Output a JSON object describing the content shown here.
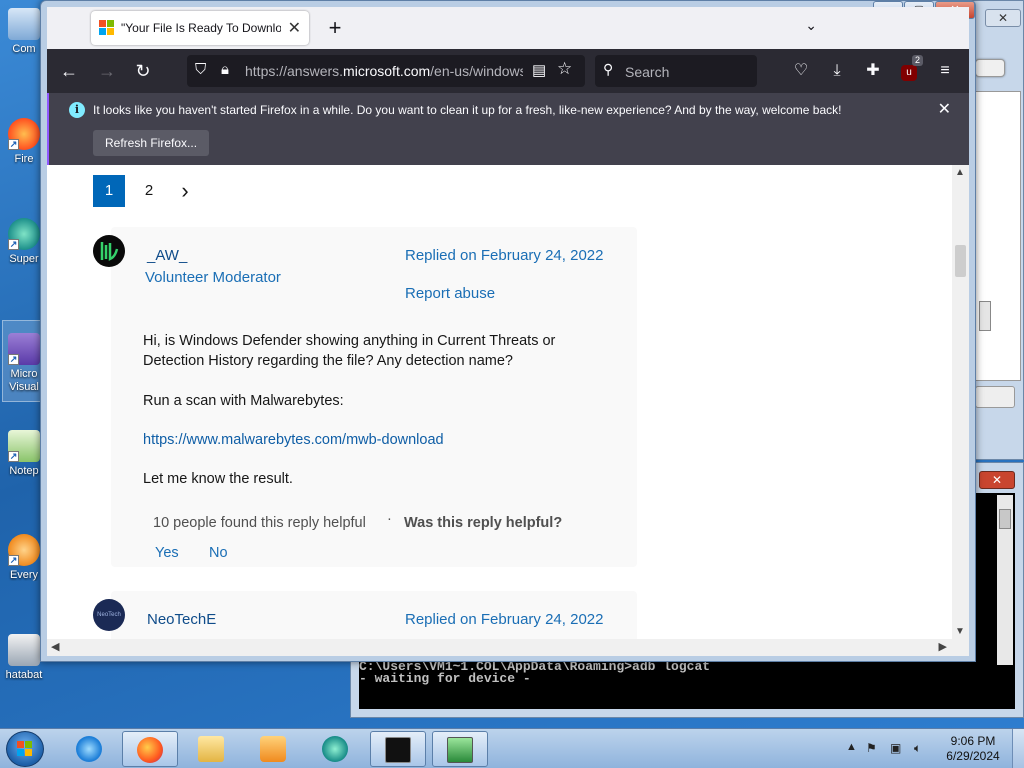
{
  "desktop": {
    "icons": [
      {
        "label": "Com"
      },
      {
        "label": "Fire"
      },
      {
        "label": "Super"
      },
      {
        "label": "Micro Visual"
      },
      {
        "label": "Notep"
      },
      {
        "label": "Every"
      },
      {
        "label": "hatabat"
      }
    ]
  },
  "browser": {
    "tab_title": "\"Your File Is Ready To Download\"",
    "url_prefix": "https://answers.",
    "url_domain": "microsoft.com",
    "url_suffix": "/en-us/windows/forum",
    "search_placeholder": "Search",
    "extension_badge": "2",
    "window_controls": {
      "minimize": "—",
      "maximize": "▢",
      "close": "✕"
    }
  },
  "notification": {
    "message": "It looks like you haven't started Firefox in a while. Do you want to clean it up for a fresh, like-new experience? And by the way, welcome back!",
    "button": "Refresh Firefox..."
  },
  "page": {
    "pagination": {
      "pages": [
        "1",
        "2"
      ],
      "current": "1",
      "next": "›"
    },
    "reply1": {
      "username": "_AW_",
      "role": "Volunteer Moderator",
      "date": "Replied on February 24, 2022",
      "report": "Report abuse",
      "body_p1": "Hi, is Windows Defender showing anything in Current Threats or Detection History regarding the file? Any detection name?",
      "body_p2": "Run a scan with Malwarebytes:",
      "link": "https://www.malwarebytes.com/mwb-download",
      "body_p3": "Let me know the result.",
      "helpful_count": "10 people found this reply helpful",
      "helpful_sep": "·",
      "was_helpful": "Was this reply helpful?",
      "yes": "Yes",
      "no": "No"
    },
    "reply2": {
      "username": "NeoTechE",
      "date": "Replied on February 24, 2022"
    }
  },
  "console": {
    "line1": "C:\\Users\\VM1~1.COL\\AppData\\Roaming>adb logcat",
    "line2": "- waiting for device -"
  },
  "taskbar": {
    "time": "9:06 PM",
    "date": "6/29/2024"
  },
  "colors": {
    "firefox_toolbar": "#2b2a33",
    "notification_bg": "#42414d",
    "link_blue": "#1a6eb5",
    "page_active": "#0067b8"
  }
}
